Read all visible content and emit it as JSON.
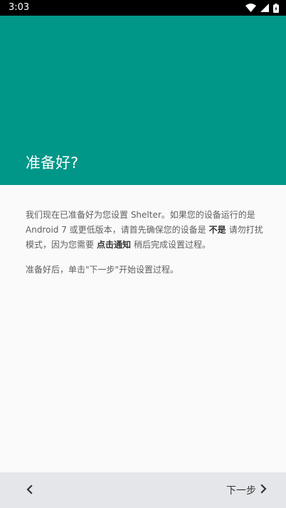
{
  "status_bar": {
    "time": "3:03",
    "icons": [
      "wifi-icon",
      "signal-icon",
      "battery-icon"
    ]
  },
  "hero": {
    "title": "准备好?",
    "background_color": "#009688"
  },
  "content": {
    "p1_part1": "我们现在已准备好为您设置 Shelter。如果您的设备运行的是 Android 7 或更低版本，请首先确保您的设备是",
    "p1_bold1": "不是",
    "p1_part2": "请勿打扰模式，因为您需要",
    "p1_bold2": "点击通知",
    "p1_part3": "稍后完成设置过程。",
    "p2": "准备好后，单击\"下一步\"开始设置过程。"
  },
  "bottom_bar": {
    "back_icon": "chevron-left-icon",
    "next_label": "下一步",
    "next_icon": "chevron-right-icon"
  }
}
